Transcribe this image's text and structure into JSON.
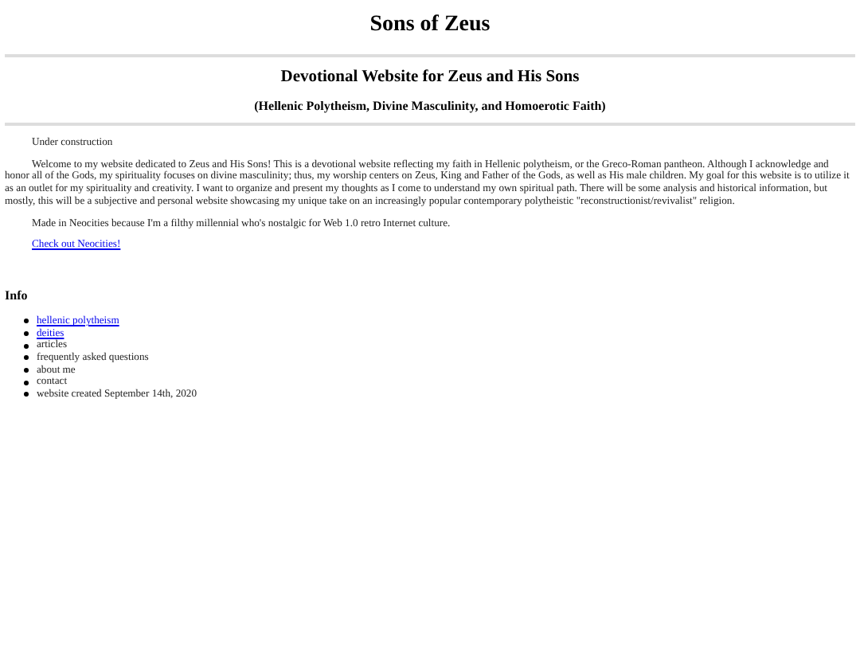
{
  "title": "Sons of Zeus",
  "subtitle": "Devotional Website for Zeus and His Sons",
  "tagline": "(Hellenic Polytheism, Divine Masculinity, and Homoerotic Faith)",
  "paragraphs": [
    {
      "kind": "text",
      "text": "Under construction"
    },
    {
      "kind": "text",
      "text": "Welcome to my website dedicated to Zeus and His Sons! This is a devotional website reflecting my faith in Hellenic polytheism, or the Greco-Roman pantheon. Although I acknowledge and honor all of the Gods, my spirituality focuses on divine masculinity; thus, my worship centers on Zeus, King and Father of the Gods, as well as His male children. My goal for this website is to utilize it as an outlet for my spirituality and creativity. I want to organize and present my thoughts as I come to understand my own spiritual path. There will be some analysis and historical information, but mostly, this will be a subjective and personal website showcasing my unique take on an increasingly popular contemporary polytheistic \"reconstructionist/revivalist\" religion."
    },
    {
      "kind": "text",
      "text": "Made in Neocities because I'm a filthy millennial who's nostalgic for Web 1.0 retro Internet culture."
    },
    {
      "kind": "link",
      "text": "Check out Neocities!"
    }
  ],
  "info": {
    "heading": "Info",
    "items": [
      {
        "kind": "link",
        "text": "hellenic polytheism"
      },
      {
        "kind": "link",
        "text": "deities"
      },
      {
        "kind": "text",
        "text": "articles"
      },
      {
        "kind": "text",
        "text": "frequently asked questions"
      },
      {
        "kind": "text",
        "text": "about me"
      },
      {
        "kind": "text",
        "text": "contact"
      },
      {
        "kind": "text",
        "text": "website created September 14th, 2020"
      }
    ]
  }
}
